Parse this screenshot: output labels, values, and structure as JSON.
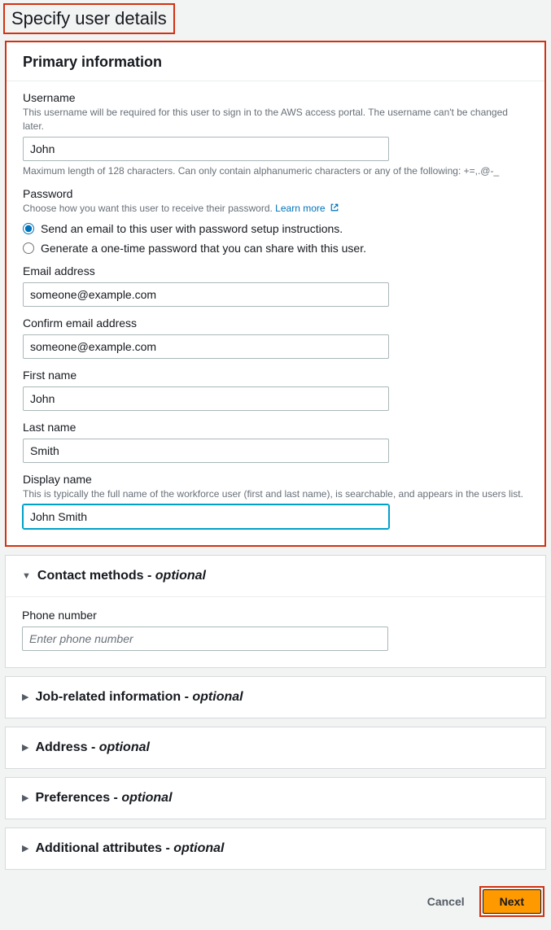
{
  "pageTitle": "Specify user details",
  "primary": {
    "heading": "Primary information",
    "username": {
      "label": "Username",
      "hint": "This username will be required for this user to sign in to the AWS access portal. The username can't be changed later.",
      "value": "John",
      "constraint": "Maximum length of 128 characters. Can only contain alphanumeric characters or any of the following: +=,.@-_"
    },
    "password": {
      "label": "Password",
      "hint": "Choose how you want this user to receive their password.",
      "learnMore": "Learn more",
      "option1": "Send an email to this user with password setup instructions.",
      "option2": "Generate a one-time password that you can share with this user."
    },
    "email": {
      "label": "Email address",
      "value": "someone@example.com"
    },
    "confirmEmail": {
      "label": "Confirm email address",
      "value": "someone@example.com"
    },
    "firstName": {
      "label": "First name",
      "value": "John"
    },
    "lastName": {
      "label": "Last name",
      "value": "Smith"
    },
    "displayName": {
      "label": "Display name",
      "hint": "This is typically the full name of the workforce user (first and last name), is searchable, and appears in the users list.",
      "value": "John Smith"
    }
  },
  "contact": {
    "heading": "Contact methods - ",
    "optional": "optional",
    "phone": {
      "label": "Phone number",
      "placeholder": "Enter phone number"
    }
  },
  "jobInfo": {
    "heading": "Job-related information - ",
    "optional": "optional"
  },
  "address": {
    "heading": "Address - ",
    "optional": "optional"
  },
  "preferences": {
    "heading": "Preferences - ",
    "optional": "optional"
  },
  "additional": {
    "heading": "Additional attributes - ",
    "optional": "optional"
  },
  "footer": {
    "cancel": "Cancel",
    "next": "Next"
  }
}
